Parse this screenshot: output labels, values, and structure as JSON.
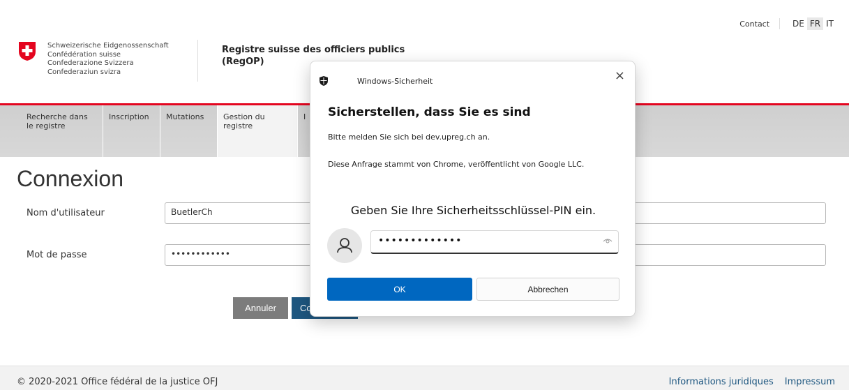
{
  "header": {
    "federation_names": [
      "Schweizerische Eidgenossenschaft",
      "Confédération suisse",
      "Confederazione Svizzera",
      "Confederaziun svizra"
    ],
    "app_title_line1": "Registre suisse des officiers publics",
    "app_title_line2": "(RegOP)",
    "contact": "Contact",
    "languages": [
      "DE",
      "FR",
      "IT"
    ],
    "active_language": "FR"
  },
  "nav": {
    "items": [
      {
        "line1": "Recherche dans",
        "line2": "le registre"
      },
      {
        "line1": "Inscription",
        "line2": ""
      },
      {
        "line1": "Mutations",
        "line2": ""
      },
      {
        "line1": "Gestion du",
        "line2": "registre"
      },
      {
        "line1": "I",
        "line2": ""
      }
    ]
  },
  "login": {
    "title": "Connexion",
    "username_label": "Nom d'utilisateur",
    "username_value": "BuetlerCh",
    "password_label": "Mot de passe",
    "password_value": "••••••••••••",
    "cancel_label": "Annuler",
    "connect_label": "Co"
  },
  "footer": {
    "copyright": "© 2020-2021 Office fédéral de la justice OFJ",
    "links": [
      "Informations juridiques",
      "Impressum"
    ]
  },
  "dialog": {
    "app_name": "Windows-Sicherheit",
    "close_glyph": "×",
    "heading": "Sicherstellen, dass Sie es sind",
    "line1": "Bitte melden Sie sich bei dev.upreg.ch an.",
    "line2": "Diese Anfrage stammt von Chrome, veröffentlicht von Google LLC.",
    "pin_prompt": "Geben Sie Ihre Sicherheitsschlüssel-PIN ein.",
    "pin_value": "•••••••••••••",
    "ok_label": "OK",
    "cancel_label": "Abbrechen"
  },
  "colors": {
    "swiss_red": "#e4051f",
    "nav_bg": "#d4d4d4",
    "primary_blue": "#1e5780",
    "windows_blue": "#0067c0"
  },
  "icons": [
    "swiss-cross-icon",
    "shield-icon",
    "close-icon",
    "user-icon",
    "eye-icon"
  ]
}
